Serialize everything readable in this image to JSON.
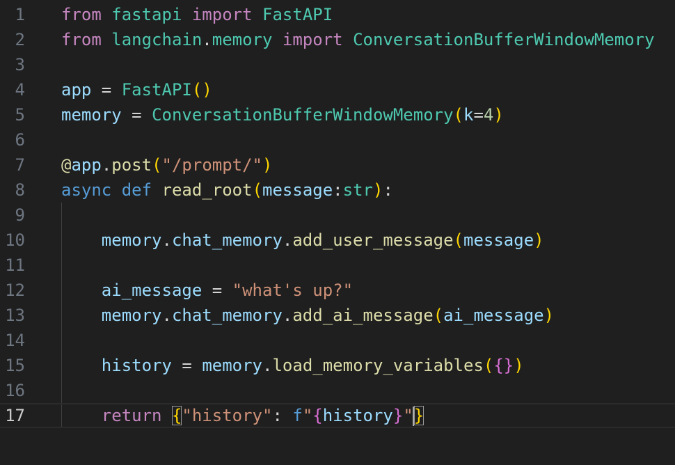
{
  "editor": {
    "language": "python",
    "current_line": 17,
    "colors": {
      "background": "#1f1f1f",
      "line_number": "#6e7681",
      "line_number_active": "#cccccc",
      "keyword_import": "#c586c0",
      "keyword_def": "#569cd6",
      "function": "#dcdcaa",
      "class_type": "#4ec9b0",
      "variable": "#9cdcfe",
      "string": "#ce9178",
      "number": "#b5cea8",
      "punctuation": "#d4d4d4",
      "bracket_1": "#ffd700",
      "bracket_2": "#da70d6",
      "bracket_3": "#179fff"
    },
    "lines": [
      {
        "number": "1",
        "tokens": [
          {
            "t": "from",
            "c": "keyword_import"
          },
          {
            "t": " ",
            "c": "punctuation"
          },
          {
            "t": "fastapi",
            "c": "class_type"
          },
          {
            "t": " ",
            "c": "punctuation"
          },
          {
            "t": "import",
            "c": "keyword_import"
          },
          {
            "t": " ",
            "c": "punctuation"
          },
          {
            "t": "FastAPI",
            "c": "class_type"
          }
        ]
      },
      {
        "number": "2",
        "tokens": [
          {
            "t": "from",
            "c": "keyword_import"
          },
          {
            "t": " ",
            "c": "punctuation"
          },
          {
            "t": "langchain",
            "c": "class_type"
          },
          {
            "t": ".",
            "c": "punctuation"
          },
          {
            "t": "memory",
            "c": "class_type"
          },
          {
            "t": " ",
            "c": "punctuation"
          },
          {
            "t": "import",
            "c": "keyword_import"
          },
          {
            "t": " ",
            "c": "punctuation"
          },
          {
            "t": "ConversationBufferWindowMemory",
            "c": "class_type"
          }
        ]
      },
      {
        "number": "3",
        "tokens": []
      },
      {
        "number": "4",
        "tokens": [
          {
            "t": "app",
            "c": "variable"
          },
          {
            "t": " = ",
            "c": "punctuation"
          },
          {
            "t": "FastAPI",
            "c": "class_type"
          },
          {
            "t": "()",
            "c": "bracket_1"
          }
        ]
      },
      {
        "number": "5",
        "tokens": [
          {
            "t": "memory",
            "c": "variable"
          },
          {
            "t": " = ",
            "c": "punctuation"
          },
          {
            "t": "ConversationBufferWindowMemory",
            "c": "class_type"
          },
          {
            "t": "(",
            "c": "bracket_1"
          },
          {
            "t": "k",
            "c": "variable"
          },
          {
            "t": "=",
            "c": "punctuation"
          },
          {
            "t": "4",
            "c": "number"
          },
          {
            "t": ")",
            "c": "bracket_1"
          }
        ]
      },
      {
        "number": "6",
        "tokens": []
      },
      {
        "number": "7",
        "tokens": [
          {
            "t": "@",
            "c": "function"
          },
          {
            "t": "app",
            "c": "variable"
          },
          {
            "t": ".",
            "c": "punctuation"
          },
          {
            "t": "post",
            "c": "function"
          },
          {
            "t": "(",
            "c": "bracket_1"
          },
          {
            "t": "\"/prompt/\"",
            "c": "string"
          },
          {
            "t": ")",
            "c": "bracket_1"
          }
        ]
      },
      {
        "number": "8",
        "tokens": [
          {
            "t": "async",
            "c": "keyword_def"
          },
          {
            "t": " ",
            "c": "punctuation"
          },
          {
            "t": "def",
            "c": "keyword_def"
          },
          {
            "t": " ",
            "c": "punctuation"
          },
          {
            "t": "read_root",
            "c": "function"
          },
          {
            "t": "(",
            "c": "bracket_1"
          },
          {
            "t": "message",
            "c": "variable"
          },
          {
            "t": ":",
            "c": "punctuation"
          },
          {
            "t": "str",
            "c": "class_type"
          },
          {
            "t": ")",
            "c": "bracket_1"
          },
          {
            "t": ":",
            "c": "punctuation"
          }
        ]
      },
      {
        "number": "9",
        "tokens": []
      },
      {
        "number": "10",
        "tokens": [
          {
            "t": "    ",
            "c": "punctuation"
          },
          {
            "t": "memory",
            "c": "variable"
          },
          {
            "t": ".",
            "c": "punctuation"
          },
          {
            "t": "chat_memory",
            "c": "variable"
          },
          {
            "t": ".",
            "c": "punctuation"
          },
          {
            "t": "add_user_message",
            "c": "function"
          },
          {
            "t": "(",
            "c": "bracket_1"
          },
          {
            "t": "message",
            "c": "variable"
          },
          {
            "t": ")",
            "c": "bracket_1"
          }
        ]
      },
      {
        "number": "11",
        "tokens": []
      },
      {
        "number": "12",
        "tokens": [
          {
            "t": "    ",
            "c": "punctuation"
          },
          {
            "t": "ai_message",
            "c": "variable"
          },
          {
            "t": " = ",
            "c": "punctuation"
          },
          {
            "t": "\"what's up?\"",
            "c": "string"
          }
        ]
      },
      {
        "number": "13",
        "tokens": [
          {
            "t": "    ",
            "c": "punctuation"
          },
          {
            "t": "memory",
            "c": "variable"
          },
          {
            "t": ".",
            "c": "punctuation"
          },
          {
            "t": "chat_memory",
            "c": "variable"
          },
          {
            "t": ".",
            "c": "punctuation"
          },
          {
            "t": "add_ai_message",
            "c": "function"
          },
          {
            "t": "(",
            "c": "bracket_1"
          },
          {
            "t": "ai_message",
            "c": "variable"
          },
          {
            "t": ")",
            "c": "bracket_1"
          }
        ]
      },
      {
        "number": "14",
        "tokens": []
      },
      {
        "number": "15",
        "tokens": [
          {
            "t": "    ",
            "c": "punctuation"
          },
          {
            "t": "history",
            "c": "variable"
          },
          {
            "t": " = ",
            "c": "punctuation"
          },
          {
            "t": "memory",
            "c": "variable"
          },
          {
            "t": ".",
            "c": "punctuation"
          },
          {
            "t": "load_memory_variables",
            "c": "function"
          },
          {
            "t": "(",
            "c": "bracket_1"
          },
          {
            "t": "{}",
            "c": "bracket_2"
          },
          {
            "t": ")",
            "c": "bracket_1"
          }
        ]
      },
      {
        "number": "16",
        "tokens": []
      },
      {
        "number": "17",
        "tokens": [
          {
            "t": "    ",
            "c": "punctuation"
          },
          {
            "t": "return",
            "c": "keyword_import"
          },
          {
            "t": " ",
            "c": "punctuation"
          },
          {
            "t": "{",
            "c": "bracket_1",
            "match": true
          },
          {
            "t": "\"history\"",
            "c": "string"
          },
          {
            "t": ": ",
            "c": "punctuation"
          },
          {
            "t": "f",
            "c": "keyword_def"
          },
          {
            "t": "\"",
            "c": "string"
          },
          {
            "t": "{",
            "c": "bracket_2"
          },
          {
            "t": "history",
            "c": "variable"
          },
          {
            "t": "}",
            "c": "bracket_2"
          },
          {
            "t": "\"",
            "c": "string"
          },
          {
            "t": "}",
            "c": "bracket_1",
            "match": true,
            "caret_before": true
          }
        ]
      }
    ]
  }
}
